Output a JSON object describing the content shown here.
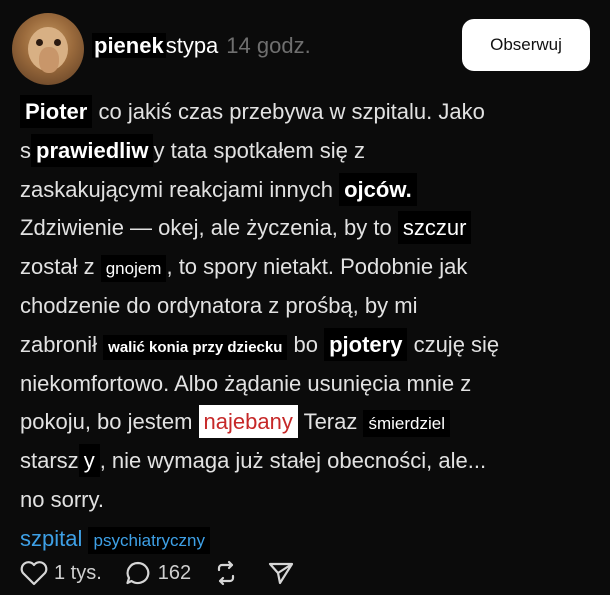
{
  "header": {
    "username_part1": "pienek",
    "username_part2": "stypa",
    "time": "14 godz.",
    "follow_label": "Obserwuj"
  },
  "post": {
    "lines": [
      [
        {
          "t": "ov",
          "v": "Pioter",
          "cls": "b"
        },
        {
          "t": "txt",
          "v": " co jakiś czas przebywa w szpitalu. Jako"
        }
      ],
      [
        {
          "t": "txt",
          "v": "s"
        },
        {
          "t": "ov",
          "v": "prawiedliw",
          "cls": "b"
        },
        {
          "t": "txt",
          "v": "y tata spotkałem się z"
        }
      ],
      [
        {
          "t": "txt",
          "v": "zaskakującymi reakcjami innych "
        },
        {
          "t": "ov",
          "v": "ojców.",
          "cls": "b"
        }
      ],
      [
        {
          "t": "txt",
          "v": "Zdziwienie — okej, ale życzenia, by to "
        },
        {
          "t": "ov",
          "v": "szczur",
          "cls": ""
        }
      ],
      [
        {
          "t": "txt",
          "v": "został  z "
        },
        {
          "t": "ov",
          "v": "gnojem",
          "cls": "sm"
        },
        {
          "t": "txt",
          "v": ", to spory nietakt. Podobnie jak"
        }
      ],
      [
        {
          "t": "txt",
          "v": "chodzenie do ordynatora z prośbą, by mi"
        }
      ],
      [
        {
          "t": "txt",
          "v": "zabronił "
        },
        {
          "t": "ov",
          "v": "walić konia przy dziecku",
          "cls": "xs"
        },
        {
          "t": "txt",
          "v": " bo "
        },
        {
          "t": "ov",
          "v": "pjotery",
          "cls": "b"
        },
        {
          "t": "txt",
          "v": " czuję się"
        }
      ],
      [
        {
          "t": "txt",
          "v": "niekomfortowo. Albo żądanie usunięcia mnie z"
        }
      ],
      [
        {
          "t": "txt",
          "v": "pokoju, bo jestem "
        },
        {
          "t": "ov",
          "v": "najebany",
          "cls": "white"
        },
        {
          "t": "txt",
          "v": " Teraz "
        },
        {
          "t": "ov",
          "v": "śmierdziel",
          "cls": "sm"
        }
      ],
      [
        {
          "t": "txt",
          "v": "starsz"
        },
        {
          "t": "ov",
          "v": "y",
          "cls": ""
        },
        {
          "t": "txt",
          "v": ", nie wymaga już stałej obecności, ale..."
        }
      ],
      [
        {
          "t": "txt",
          "v": "no sorry."
        }
      ]
    ],
    "tag_word": "szpital",
    "tag_overlay": "psychiatryczny"
  },
  "actions": {
    "likes": "1 tys.",
    "comments": "162",
    "icons": [
      "heart-icon",
      "comment-icon",
      "repost-icon",
      "share-icon"
    ]
  },
  "colors": {
    "background": "#0b0b0b",
    "tag": "#3ea0e6",
    "redacted_red": "#c62828"
  }
}
